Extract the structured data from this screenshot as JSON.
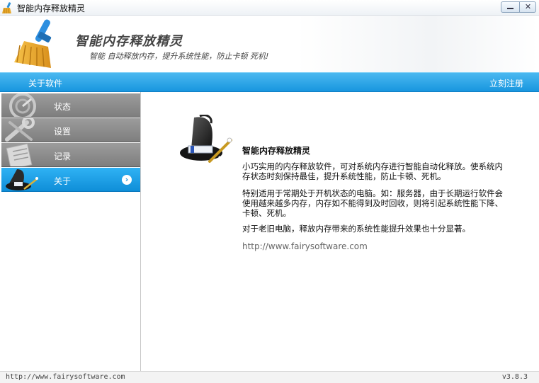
{
  "window": {
    "title": "智能内存释放精灵",
    "icon": "broom-icon",
    "close_glyph": "✕"
  },
  "header": {
    "title": "智能内存释放精灵",
    "slogan": "智能 自动释放内存，提升系统性能，防止卡顿 死机!"
  },
  "navbar": {
    "about_label": "关于软件",
    "register_label": "立刻注册"
  },
  "sidebar": {
    "items": [
      {
        "label": "状态",
        "icon": "speedometer-icon"
      },
      {
        "label": "设置",
        "icon": "wrench-icon"
      },
      {
        "label": "记录",
        "icon": "document-icon"
      },
      {
        "label": "关于",
        "icon": "wizard-hat-icon",
        "active": true,
        "arrow": "›"
      }
    ]
  },
  "about": {
    "title": "智能内存释放精灵",
    "p1": "小巧实用的内存释放软件，可对系统内存进行智能自动化释放。使系统内存状态时刻保持最佳，提升系统性能，防止卡顿、死机。",
    "p2": "特别适用于常期处于开机状态的电脑。如：服务器，由于长期运行软件会使用越来越多内存，内存如不能得到及时回收，则将引起系统性能下降、卡顿、死机。",
    "p3": "对于老旧电脑，释放内存带来的系统性能提升效果也十分显著。",
    "url": "http://www.fairysoftware.com"
  },
  "statusbar": {
    "left": "http://www.fairysoftware.com",
    "right": "v3.8.3"
  },
  "colors": {
    "accent_blue": "#1896df",
    "sidebar_gray": "#8c8c8c",
    "active_blue": "#1c9ee6"
  }
}
